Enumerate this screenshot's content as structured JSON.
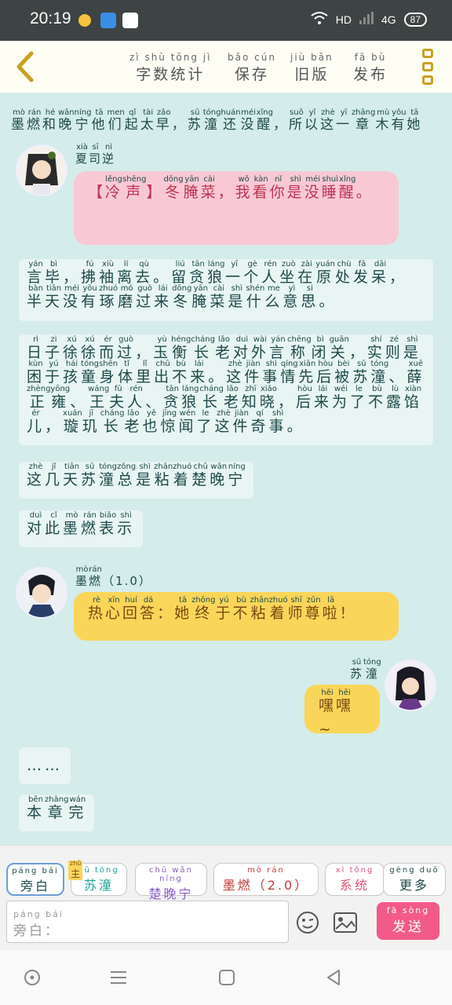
{
  "status": {
    "time": "20:19",
    "network": "HD",
    "signal": "4G",
    "battery": "87"
  },
  "toolbar": {
    "tools": [
      {
        "py": "zì shù tǒng jì",
        "hz": "字数统计"
      },
      {
        "py": "bǎo cún",
        "hz": "保存"
      },
      {
        "py": "jiù bǎn",
        "hz": "旧版"
      },
      {
        "py": "fā bù",
        "hz": "发布"
      }
    ]
  },
  "top_line": [
    [
      "墨",
      "mò"
    ],
    [
      "燃",
      "rán"
    ],
    [
      "和",
      "hé"
    ],
    [
      "晚",
      "wǎn"
    ],
    [
      "宁",
      "níng"
    ],
    [
      "他",
      "tā"
    ],
    [
      "们",
      "men"
    ],
    [
      "起",
      "qǐ"
    ],
    [
      "太",
      "tài"
    ],
    [
      "早",
      "zǎo"
    ],
    [
      "，",
      ""
    ],
    [
      "苏",
      "sū"
    ],
    [
      "潼",
      "tóng"
    ],
    [
      "还",
      "huán"
    ],
    [
      "没",
      "méi"
    ],
    [
      "醒",
      "xǐng"
    ],
    [
      "，",
      ""
    ],
    [
      "所",
      "suǒ"
    ],
    [
      "以",
      "yǐ"
    ],
    [
      "这",
      "zhè"
    ],
    [
      "一",
      "yī"
    ],
    [
      "章",
      "zhāng"
    ],
    [
      "木",
      "mù"
    ],
    [
      "有",
      "yǒu"
    ],
    [
      "她",
      "tā"
    ]
  ],
  "msg1": {
    "speaker": [
      [
        "夏",
        "xià"
      ],
      [
        "司",
        "sī"
      ],
      [
        "逆",
        "nì"
      ]
    ],
    "text": [
      [
        "【",
        ""
      ],
      [
        "冷",
        "lěng"
      ],
      [
        "声",
        "shēng"
      ],
      [
        "】",
        ""
      ],
      [
        "冬",
        "dōng"
      ],
      [
        "腌",
        "yān"
      ],
      [
        "菜",
        "cài"
      ],
      [
        "，",
        ""
      ],
      [
        "我",
        "wǒ"
      ],
      [
        "看",
        "kàn"
      ],
      [
        "你",
        "nǐ"
      ],
      [
        "是",
        "shì"
      ],
      [
        "没",
        "méi"
      ],
      [
        "睡",
        "shuì"
      ],
      [
        "醒",
        "xǐng"
      ],
      [
        "。",
        ""
      ]
    ]
  },
  "narr1": [
    [
      "言",
      "yán"
    ],
    [
      "毕",
      "bì"
    ],
    [
      "，",
      ""
    ],
    [
      "拂",
      "fú"
    ],
    [
      "袖",
      "xiù"
    ],
    [
      "离",
      "lí"
    ],
    [
      "去",
      "qù"
    ],
    [
      "。",
      ""
    ],
    [
      "留",
      "liú"
    ],
    [
      "贪",
      "tān"
    ],
    [
      "狼",
      "láng"
    ],
    [
      "一",
      "yī"
    ],
    [
      "个",
      "gè"
    ],
    [
      "人",
      "rén"
    ],
    [
      "坐",
      "zuò"
    ],
    [
      "在",
      "zài"
    ],
    [
      "原",
      "yuán"
    ],
    [
      "处",
      "chù"
    ],
    [
      "发",
      "fā"
    ],
    [
      "呆",
      "dāi"
    ],
    [
      "，",
      ""
    ],
    [
      "半",
      "bàn"
    ],
    [
      "天",
      "tiān"
    ],
    [
      "没",
      "méi"
    ],
    [
      "有",
      "yǒu"
    ],
    [
      "琢",
      "zhuó"
    ],
    [
      "磨",
      "mó"
    ],
    [
      "过",
      "guò"
    ],
    [
      "来",
      "lái"
    ],
    [
      "冬",
      "dōng"
    ],
    [
      "腌",
      "yān"
    ],
    [
      "菜",
      "cài"
    ],
    [
      "是",
      "shì"
    ],
    [
      "什",
      "shén"
    ],
    [
      "么",
      "me"
    ],
    [
      "意",
      "yì"
    ],
    [
      "思",
      "si"
    ],
    [
      "。",
      ""
    ]
  ],
  "narr2": [
    [
      "日",
      "rì"
    ],
    [
      "子",
      "zi"
    ],
    [
      "徐",
      "xú"
    ],
    [
      "徐",
      "xú"
    ],
    [
      "而",
      "ér"
    ],
    [
      "过",
      "guò"
    ],
    [
      "，",
      ""
    ],
    [
      "玉",
      "yù"
    ],
    [
      "衡",
      "héng"
    ],
    [
      "长",
      "cháng"
    ],
    [
      "老",
      "lǎo"
    ],
    [
      "对",
      "duì"
    ],
    [
      "外",
      "wài"
    ],
    [
      "言",
      "yán"
    ],
    [
      "称",
      "chēng"
    ],
    [
      "闭",
      "bì"
    ],
    [
      "关",
      "guān"
    ],
    [
      "，",
      ""
    ],
    [
      "实",
      "shí"
    ],
    [
      "则",
      "zé"
    ],
    [
      "是",
      "shì"
    ],
    [
      "困",
      "kùn"
    ],
    [
      "于",
      "yú"
    ],
    [
      "孩",
      "hái"
    ],
    [
      "童",
      "tóng"
    ],
    [
      "身",
      "shēn"
    ],
    [
      "体",
      "tǐ"
    ],
    [
      "里",
      "lǐ"
    ],
    [
      "出",
      "chū"
    ],
    [
      "不",
      "bù"
    ],
    [
      "来",
      "lái"
    ],
    [
      "。",
      ""
    ],
    [
      "这",
      "zhè"
    ],
    [
      "件",
      "jiàn"
    ],
    [
      "事",
      "shì"
    ],
    [
      "情",
      "qíng"
    ],
    [
      "先",
      "xiān"
    ],
    [
      "后",
      "hòu"
    ],
    [
      "被",
      "bèi"
    ],
    [
      "苏",
      "sū"
    ],
    [
      "潼",
      "tóng"
    ],
    [
      "、",
      ""
    ],
    [
      "薛",
      "xuē"
    ],
    [
      "正",
      "zhèng"
    ],
    [
      "雍",
      "yōng"
    ],
    [
      "、",
      ""
    ],
    [
      "王",
      "wáng"
    ],
    [
      "夫",
      "fū"
    ],
    [
      "人",
      "rén"
    ],
    [
      "、",
      ""
    ],
    [
      "贪",
      "tān"
    ],
    [
      "狼",
      "láng"
    ],
    [
      "长",
      "cháng"
    ],
    [
      "老",
      "lǎo"
    ],
    [
      "知",
      "zhī"
    ],
    [
      "晓",
      "xiǎo"
    ],
    [
      "，",
      ""
    ],
    [
      "后",
      "hòu"
    ],
    [
      "来",
      "lái"
    ],
    [
      "为",
      "wéi"
    ],
    [
      "了",
      "le"
    ],
    [
      "不",
      "bù"
    ],
    [
      "露",
      "lù"
    ],
    [
      "馅",
      "xiàn"
    ],
    [
      "儿",
      "ér"
    ],
    [
      "，",
      ""
    ],
    [
      "璇",
      "xuán"
    ],
    [
      "玑",
      "jī"
    ],
    [
      "长",
      "cháng"
    ],
    [
      "老",
      "lǎo"
    ],
    [
      "也",
      "yě"
    ],
    [
      "惊",
      "jīng"
    ],
    [
      "闻",
      "wén"
    ],
    [
      "了",
      "le"
    ],
    [
      "这",
      "zhè"
    ],
    [
      "件",
      "jiàn"
    ],
    [
      "奇",
      "qí"
    ],
    [
      "事",
      "shì"
    ],
    [
      "。",
      ""
    ]
  ],
  "narr3": [
    [
      "这",
      "zhè"
    ],
    [
      "几",
      "jǐ"
    ],
    [
      "天",
      "tiān"
    ],
    [
      "苏",
      "sū"
    ],
    [
      "潼",
      "tóng"
    ],
    [
      "总",
      "zǒng"
    ],
    [
      "是",
      "shì"
    ],
    [
      "粘",
      "zhān"
    ],
    [
      "着",
      "zhuó"
    ],
    [
      "楚",
      "chǔ"
    ],
    [
      "晚",
      "wǎn"
    ],
    [
      "宁",
      "níng"
    ]
  ],
  "narr4": [
    [
      "对",
      "duì"
    ],
    [
      "此",
      "cǐ"
    ],
    [
      "墨",
      "mò"
    ],
    [
      "燃",
      "rán"
    ],
    [
      "表",
      "biǎo"
    ],
    [
      "示",
      "shì"
    ]
  ],
  "msg2": {
    "speaker": [
      [
        "墨",
        "mò"
      ],
      [
        "燃",
        "rán"
      ],
      [
        "（",
        ""
      ],
      [
        "1.0",
        ""
      ],
      [
        "）",
        ""
      ]
    ],
    "text": [
      [
        "热",
        "rè"
      ],
      [
        "心",
        "xīn"
      ],
      [
        "回",
        "huí"
      ],
      [
        "答",
        "dá"
      ],
      [
        "：",
        ""
      ],
      [
        "她",
        "tā"
      ],
      [
        "终",
        "zhōng"
      ],
      [
        "于",
        "yú"
      ],
      [
        "不",
        "bù"
      ],
      [
        "粘",
        "zhān"
      ],
      [
        "着",
        "zhuó"
      ],
      [
        "师",
        "shī"
      ],
      [
        "尊",
        "zūn"
      ],
      [
        "啦",
        "lā"
      ],
      [
        "！",
        ""
      ]
    ]
  },
  "msg3": {
    "speaker": [
      [
        "苏",
        "sū"
      ],
      [
        "潼",
        "tóng"
      ]
    ],
    "text": [
      [
        "嘿",
        "hēi"
      ],
      [
        "嘿",
        "hēi"
      ],
      [
        "~",
        ""
      ]
    ]
  },
  "narr5": "……",
  "narr6": [
    [
      "本",
      "běn"
    ],
    [
      "章",
      "zhāng"
    ],
    [
      "完",
      "wán"
    ]
  ],
  "panel": {
    "chips": [
      {
        "py": "páng bái",
        "hz": "旁白",
        "color": "#333333"
      },
      {
        "py": "sū tóng",
        "hz": "苏潼",
        "color": "#1aa39a",
        "badge": "主",
        "badge_py": "zhǔ"
      },
      {
        "py": "chǔ wǎn níng",
        "hz": "楚晚宁",
        "color": "#8a5cc9"
      },
      {
        "py": "mò rán",
        "hz": "墨燃（2.0）",
        "color": "#c03a3a"
      },
      {
        "py": "xì tǒng",
        "hz": "系统",
        "color": "#e0527a"
      },
      {
        "py": "gèng duō",
        "hz": "更多",
        "color": "#333333"
      }
    ],
    "input_py": "páng bái",
    "input_hz": "旁白：",
    "send_py": "fā sòng",
    "send_hz": "发送"
  }
}
